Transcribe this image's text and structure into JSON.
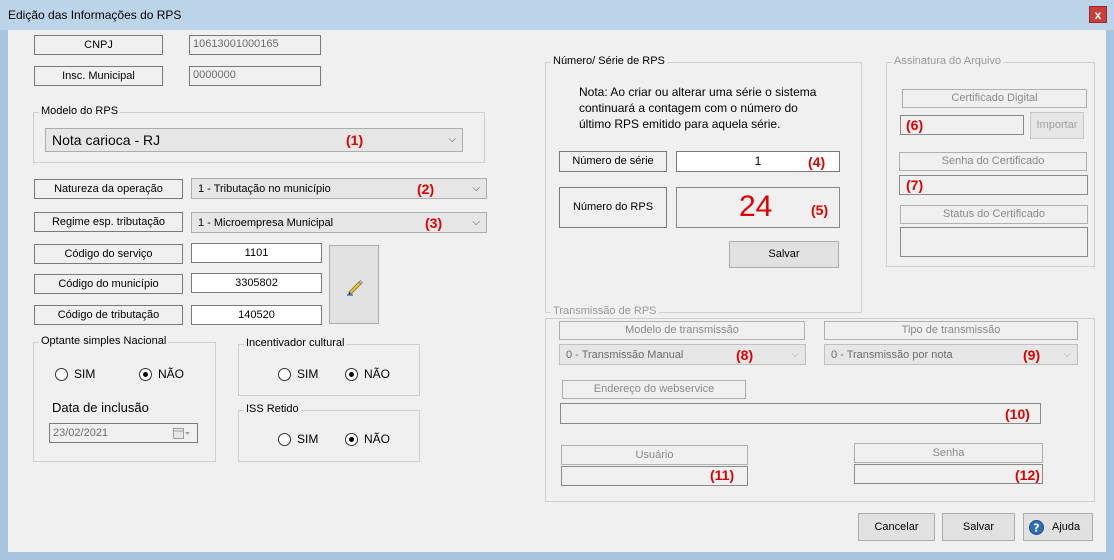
{
  "window": {
    "title": "Edição das Informações do RPS",
    "close_glyph": "x"
  },
  "cnpj": {
    "label": "CNPJ",
    "value": "10613001000165"
  },
  "insc": {
    "label": "Insc. Municipal",
    "value": "0000000"
  },
  "modelo": {
    "group": "Modelo do RPS",
    "value": "Nota carioca - RJ",
    "marker": "(1)"
  },
  "natureza": {
    "label": "Natureza da operação",
    "value": "1 - Tributação no município",
    "marker": "(2)"
  },
  "regime": {
    "label": "Regime esp. tributação",
    "value": "1 - Microempresa Municipal",
    "marker": "(3)"
  },
  "codigos": {
    "servico_label": "Código do serviço",
    "servico_value": "1101",
    "municipio_label": "Código do município",
    "municipio_value": "3305802",
    "tributacao_label": "Código de tributação",
    "tributacao_value": "140520"
  },
  "optante": {
    "group": "Optante simples Nacional",
    "sim": "SIM",
    "nao": "NÃO",
    "date_label": "Data de inclusão",
    "date_value": "23/02/2021",
    "selected": "NÃO"
  },
  "incentivador": {
    "group": "Incentivador cultural",
    "sim": "SIM",
    "nao": "NÃO",
    "selected": "NÃO"
  },
  "iss": {
    "group": "ISS Retido",
    "sim": "SIM",
    "nao": "NÃO",
    "selected": "NÃO"
  },
  "serie": {
    "group": "Número/ Série de RPS",
    "note": [
      "Nota: Ao criar ou alterar uma série o sistema",
      "continuará a contagem com o número do",
      "último RPS emitido para aquela série."
    ],
    "numero_serie_label": "Número de série",
    "numero_serie_value": "1",
    "marker_serie": "(4)",
    "numero_rps_label": "Número do RPS",
    "numero_rps_value": "24",
    "marker_rps": "(5)",
    "save": "Salvar"
  },
  "assinatura": {
    "group": "Assinatura do Arquivo",
    "cert_label": "Certificado Digital",
    "cert_marker": "(6)",
    "import": "Importar",
    "senha_label": "Senha do Certificado",
    "senha_marker": "(7)",
    "status_label": "Status do Certificado"
  },
  "transmissao": {
    "group": "Transmissão de RPS",
    "modelo_label": "Modelo de transmissão",
    "modelo_value": "0 - Transmissão Manual",
    "modelo_marker": "(8)",
    "tipo_label": "Tipo de transmissão",
    "tipo_value": "0 - Transmissão por nota",
    "tipo_marker": "(9)",
    "endereco_label": "Endereço do webservice",
    "endereco_marker": "(10)",
    "usuario_label": "Usuário",
    "usuario_marker": "(11)",
    "senha_label": "Senha",
    "senha_marker": "(12)"
  },
  "footer": {
    "cancel": "Cancelar",
    "save": "Salvar",
    "help": "Ajuda"
  },
  "colors": {
    "marker": "#e00000",
    "rps_number": "#e00000",
    "title_bar": "#bcd4ea",
    "close": "#c7403c"
  },
  "icons": [
    "close-icon",
    "pen-icon",
    "calendar-icon",
    "help-icon",
    "chevron-down-icon"
  ]
}
